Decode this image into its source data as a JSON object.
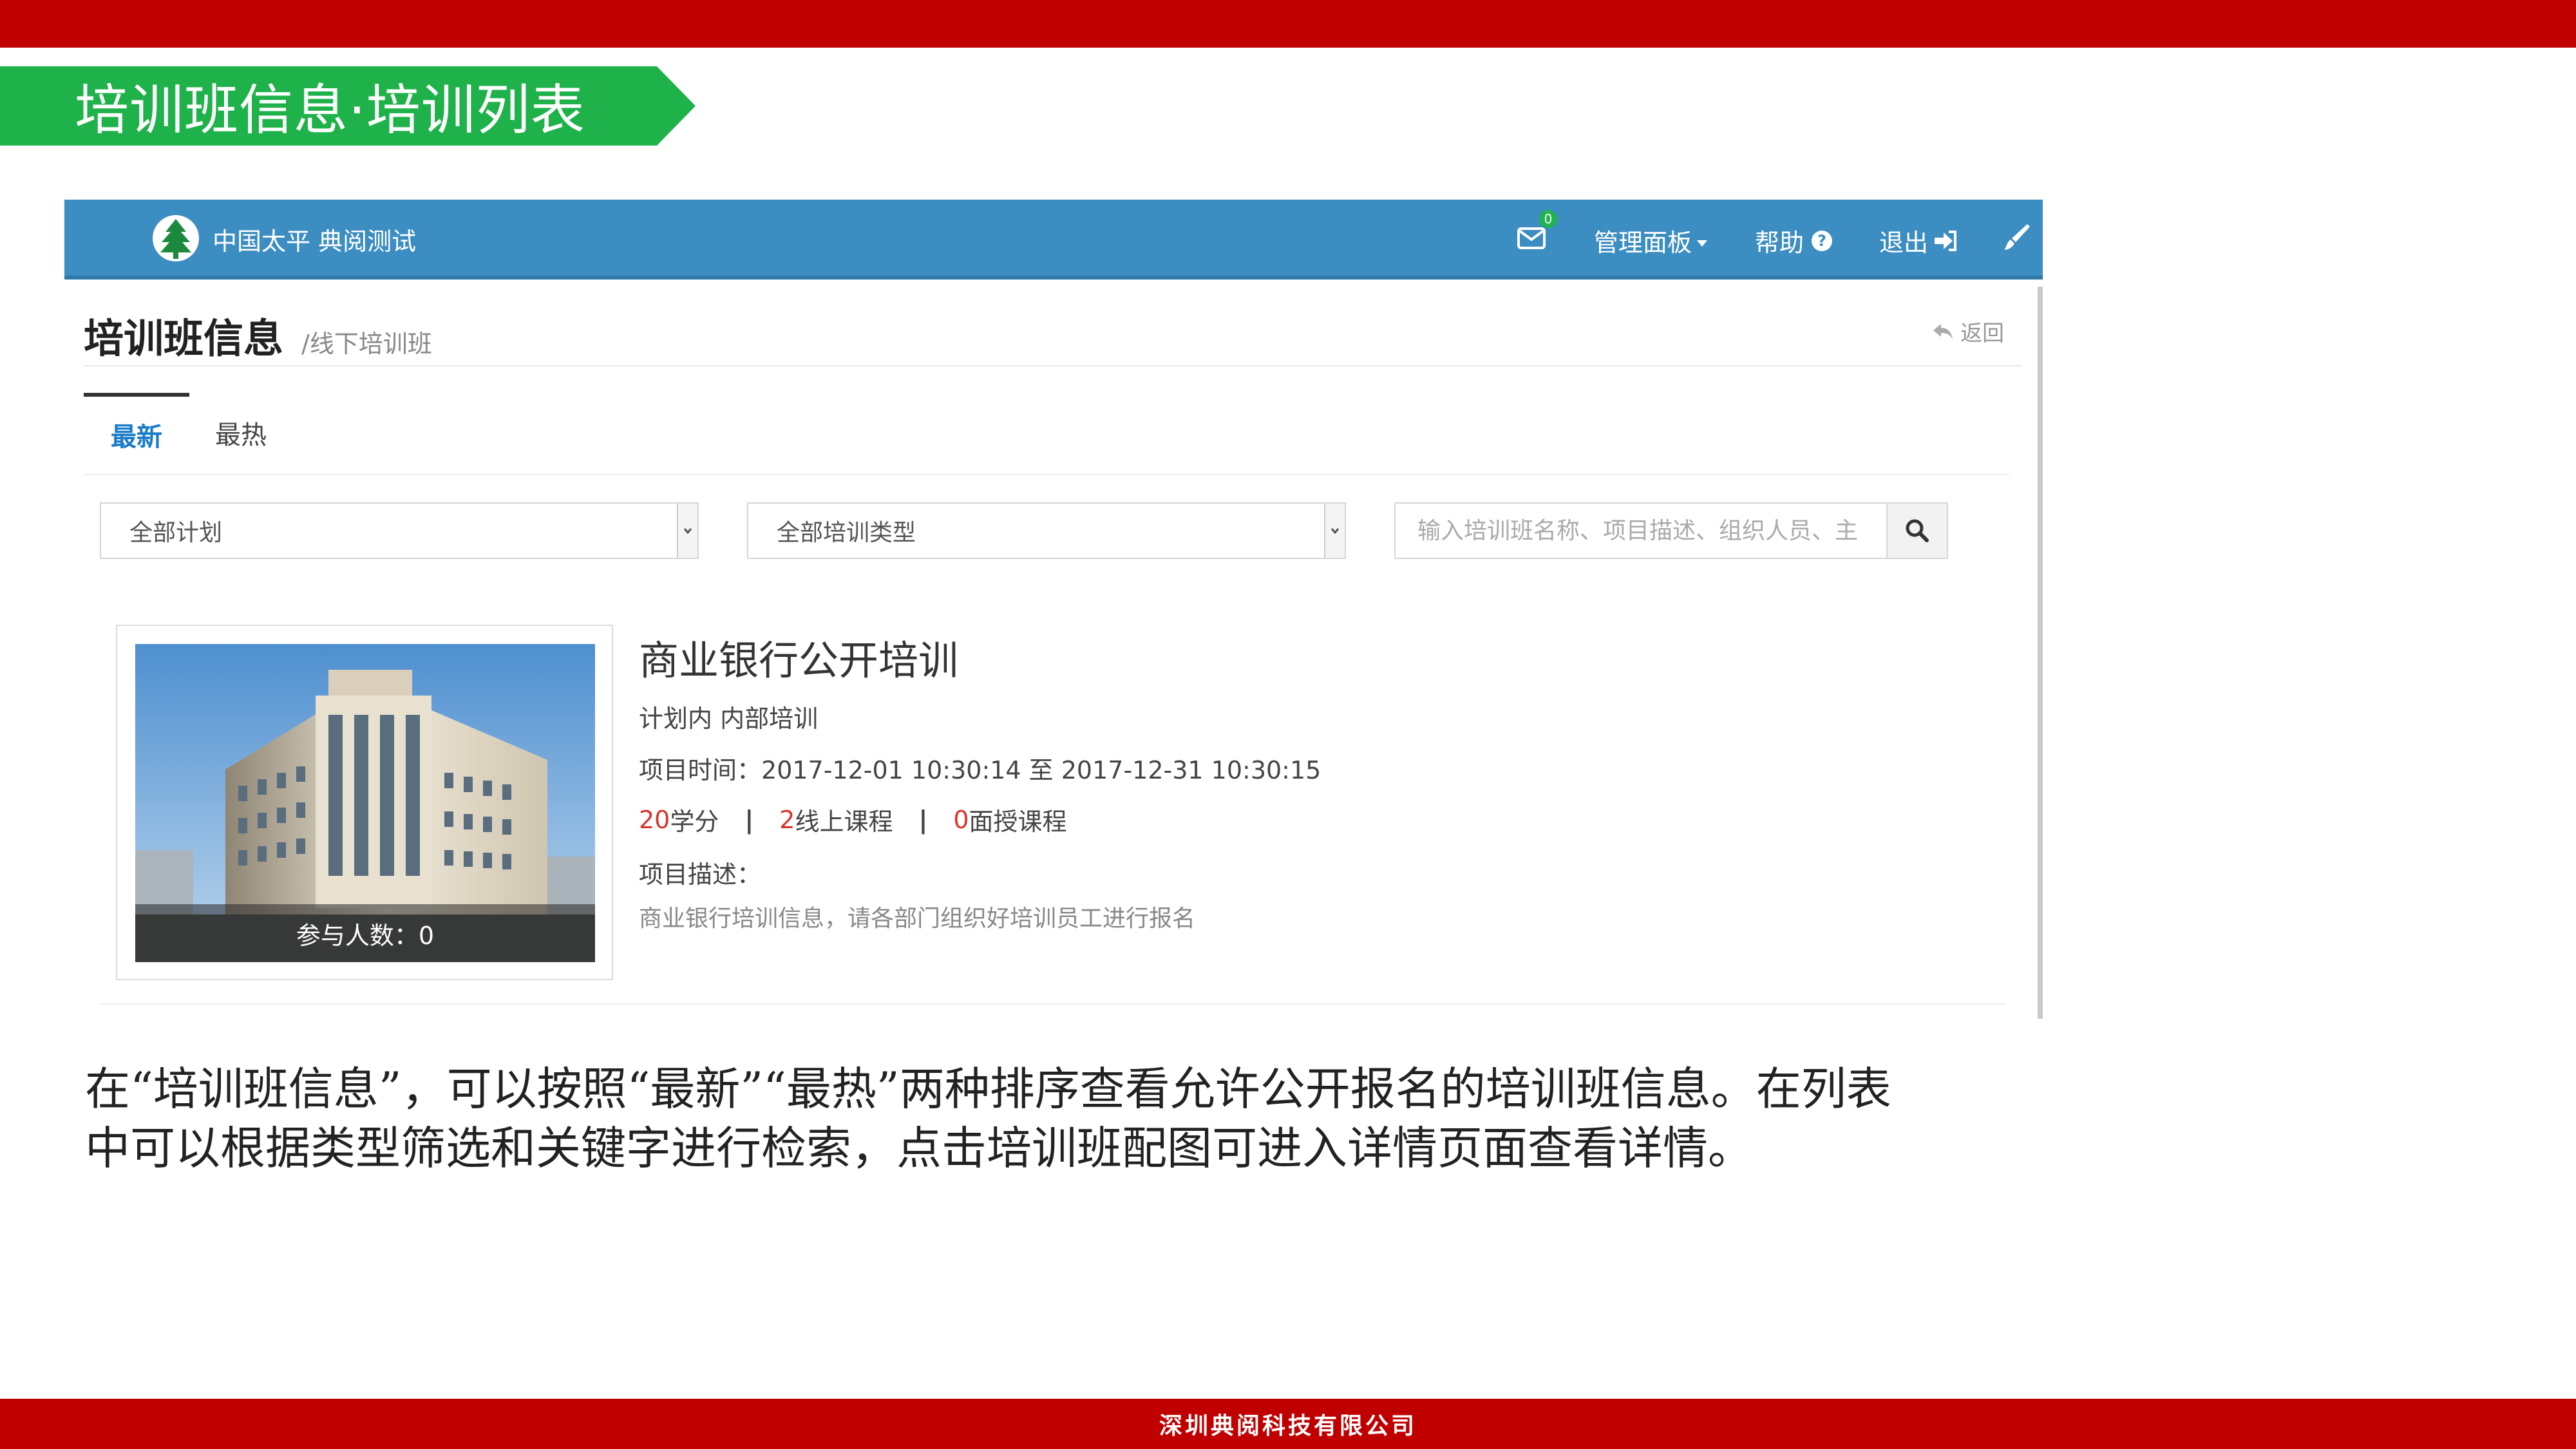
{
  "slide": {
    "title": "培训班信息·培训列表",
    "caption_line1": "在“培训班信息”，可以按照“最新”“最热”两种排序查看允许公开报名的培训班信息。在列表",
    "caption_line2": "中可以根据类型筛选和关键字进行检索，点击培训班配图可进入详情页面查看详情。",
    "footer": "深圳典阅科技有限公司",
    "colors": {
      "header_red": "#c00000",
      "title_green": "#1fb24a"
    }
  },
  "app": {
    "navbar": {
      "brand": "中国太平 典阅测试",
      "mail_badge": "0",
      "panel_label": "管理面板",
      "help_label": "帮助",
      "logout_label": "退出",
      "color": "#3c8dc1",
      "icons": [
        "menu-icon",
        "pine-logo-icon",
        "mail-icon",
        "question-circle-icon",
        "sign-out-icon",
        "paint-brush-icon"
      ]
    },
    "page": {
      "title": "培训班信息",
      "subtitle": "/线下培训班",
      "back_label": "返回"
    },
    "tabs": [
      {
        "label": "最新",
        "active": true
      },
      {
        "label": "最热",
        "active": false
      }
    ],
    "filters": {
      "plan_select": "全部计划",
      "type_select": "全部培训类型",
      "search_placeholder": "输入培训班名称、项目描述、组织人员、主"
    },
    "course": {
      "title": "商业银行公开培训",
      "plan_tags": "计划内 内部培训",
      "time_label": "项目时间：",
      "time_value": "2017-12-01 10:30:14 至 2017-12-31 10:30:15",
      "credits_num": "20",
      "credits_label": "学分",
      "online_num": "2",
      "online_label": "线上课程",
      "offline_num": "0",
      "offline_label": "面授课程",
      "separator": "|",
      "desc_label": "项目描述：",
      "desc": "商业银行培训信息，请各部门组织好培训员工进行报名",
      "participants": "参与人数：0"
    }
  }
}
